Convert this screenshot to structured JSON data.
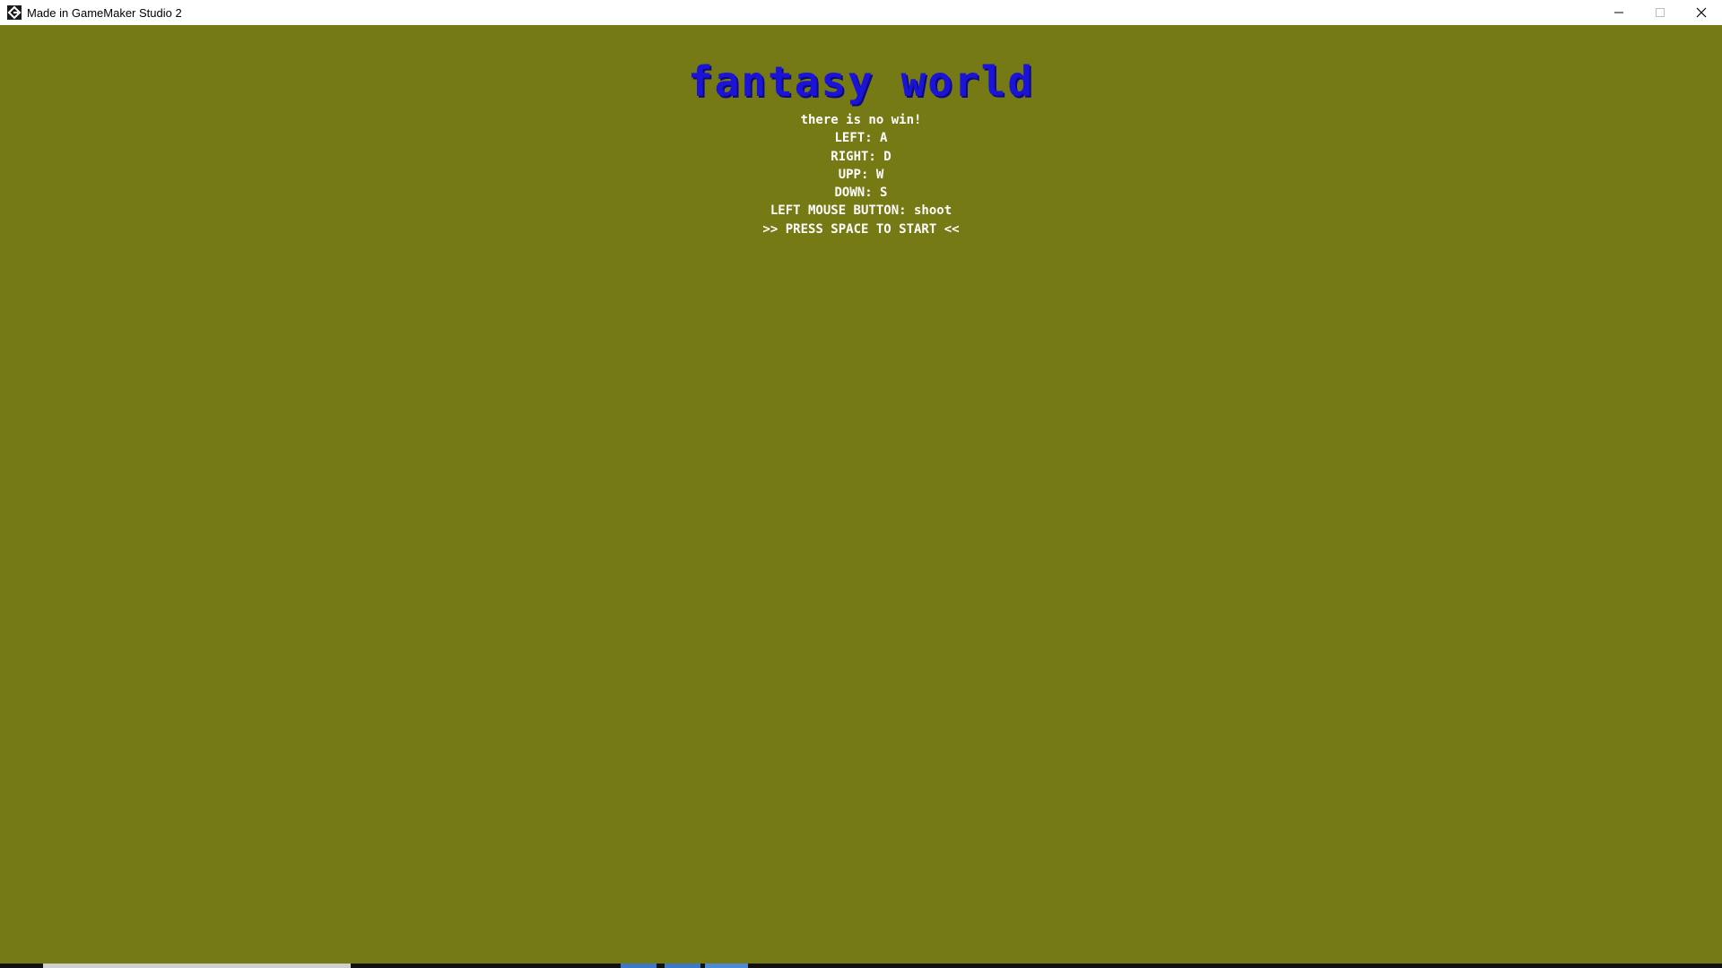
{
  "window": {
    "title": "Made in GameMaker Studio 2",
    "controls": [
      "minimize-icon",
      "maximize-icon",
      "close-icon"
    ]
  },
  "game": {
    "title": "fantasy world",
    "title_color": "#1b14d8",
    "background_color": "#767a14",
    "lines": [
      "there is no win!",
      "LEFT: A",
      "RIGHT: D",
      "UPP: W",
      "DOWN: S",
      "LEFT MOUSE BUTTON: shoot",
      ">> PRESS SPACE TO START <<"
    ]
  }
}
